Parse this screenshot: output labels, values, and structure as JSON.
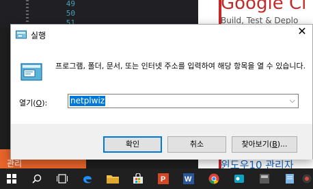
{
  "background": {
    "editor_line_numbers": [
      "49",
      "50",
      "51"
    ],
    "web_title": "Google Cl",
    "web_subtitle": "Build, Test & Deplo",
    "web_bottom_text": "윈도우10 관리자",
    "orange_panel_text": "관리"
  },
  "dialog": {
    "title": "실행",
    "description": "프로그램, 폴더, 문서, 또는 인터넷 주소를 입력하여 해당 항목을 열 수 있습니다.",
    "open_label": "열기(",
    "open_label_key": "O",
    "open_label_end": "):",
    "input_value": "netplwiz",
    "ok_label": "확인",
    "cancel_label": "취소",
    "browse_label": "찾아보기(",
    "browse_key": "B",
    "browse_label_end": ")..."
  },
  "taskbar": {
    "items": [
      "start-icon",
      "search-icon",
      "task-view-icon",
      "edge-icon",
      "file-explorer-icon",
      "store-icon",
      "powerpoint-icon",
      "word-icon",
      "chrome-icon",
      "paint-icon",
      "app-icon",
      "notepad-icon",
      "media-icon"
    ]
  },
  "colors": {
    "accent": "#0078d7",
    "taskbar": "#202020",
    "web_accent": "#c62828"
  }
}
